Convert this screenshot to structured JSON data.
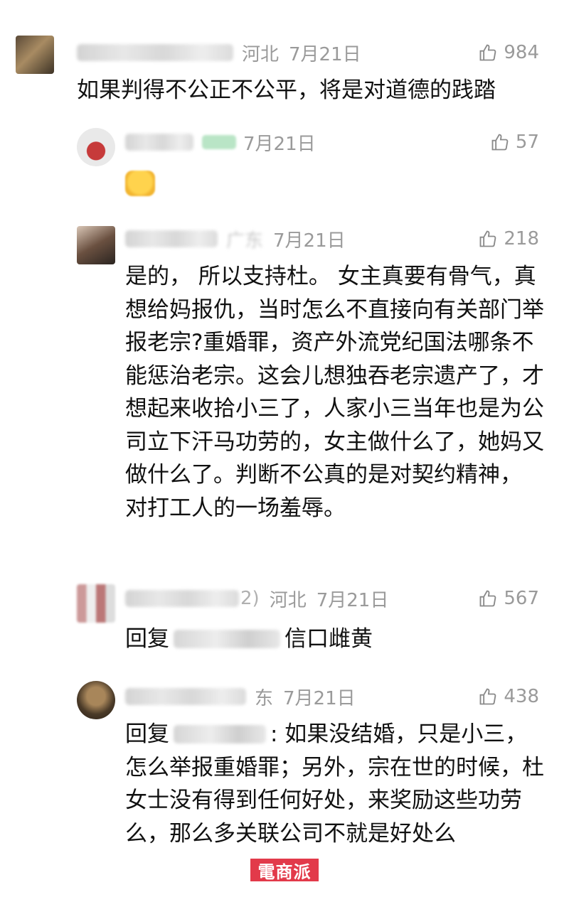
{
  "comments": [
    {
      "location": "河北",
      "date": "7月21日",
      "likes": "984",
      "text": "如果判得不公正不公平，将是对道德的践踏"
    },
    {
      "date": "7月21日",
      "likes": "57",
      "emoji": "grimace-emoji"
    },
    {
      "location": "广东",
      "date": "7月21日",
      "likes": "218",
      "text": "是的， 所以支持杜。  女主真要有骨气，真想给妈报仇，当时怎么不直接向有关部门举报老宗?重婚罪，资产外流党纪国法哪条不能惩治老宗。这会儿想独吞老宗遗产了，才想起来收拾小三了，人家小三当年也是为公司立下汗马功劳的，女主做什么了，她妈又做什么了。判断不公真的是对契约精神， 对打工人的一场羞辱。"
    },
    {
      "name_suffix": "2)",
      "location": "河北",
      "date": "7月21日",
      "likes": "567",
      "reply_prefix": "回复",
      "text": "信口雌黄"
    },
    {
      "location": "东",
      "date": "7月21日",
      "likes": "438",
      "reply_prefix": "回复",
      "text": ": 如果没结婚，只是小三，怎么举报重婚罪；另外，宗在世的时候，杜女士没有得到任何好处，来奖励这些功劳么，那么多关联公司不就是好处么"
    }
  ],
  "watermark": "電商派",
  "colors": {
    "meta": "#9a9a9a",
    "text": "#111111",
    "watermark_bg": "#e23a4a"
  }
}
